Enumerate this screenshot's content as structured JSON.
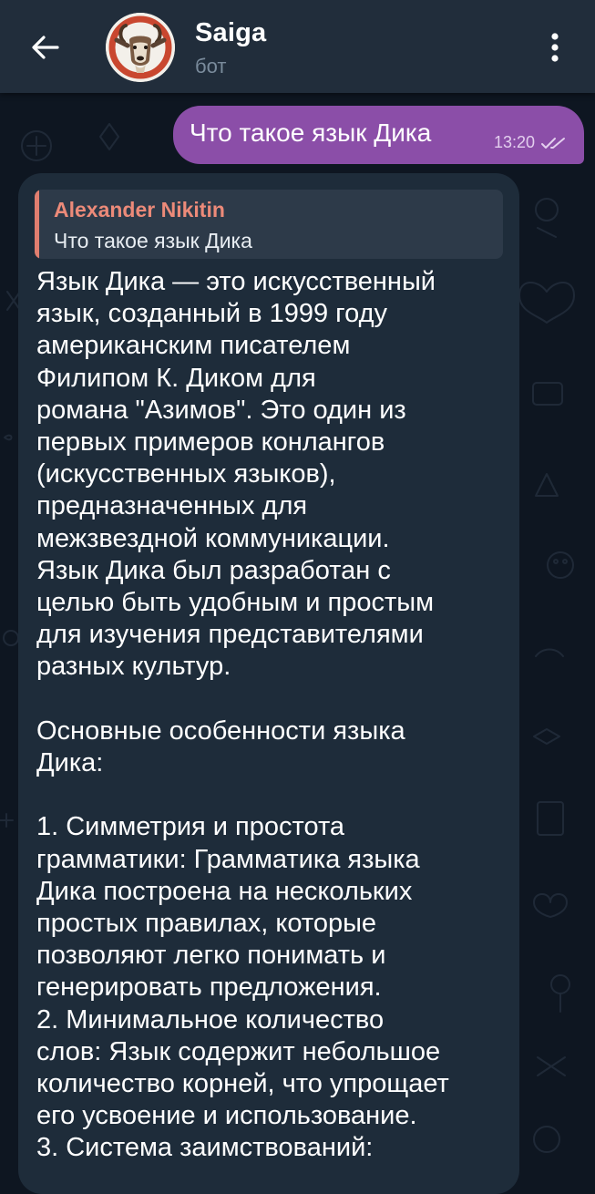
{
  "colors": {
    "background": "#0e1621",
    "header": "#212d3b",
    "outgoing_bubble": "#8b4ea8",
    "incoming_bubble": "#1e2c3a",
    "reply_accent": "#ec8a79"
  },
  "header": {
    "back_icon": "arrow-left-icon",
    "avatar_icon": "goat-avatar",
    "title": "Saiga",
    "subtitle": "бот",
    "menu_icon": "more-vertical-icon"
  },
  "outgoing": {
    "text": "Что такое язык Дика",
    "time": "13:20",
    "status_icon": "double-check-icon"
  },
  "incoming": {
    "reply_author": "Alexander Nikitin",
    "reply_text": "Что такое язык Дика",
    "lines": [
      "Язык Дика — это искусственный",
      "язык, созданный в 1999 году",
      "американским писателем",
      "Филипом К. Диком для",
      "романа \"Азимов\". Это один из",
      "первых примеров конлангов",
      "(искусственных языков),",
      "предназначенных для",
      "межзвездной коммуникации.",
      "Язык Дика был разработан с",
      "целью быть удобным и простым",
      "для изучения представителями",
      "разных культур.",
      "",
      "Основные особенности языка",
      "Дика:",
      "",
      "1. Симметрия и простота",
      "грамматики: Грамматика языка",
      "Дика построена на нескольких",
      "простых правилах, которые",
      "позволяют легко понимать и",
      "генерировать предложения.",
      "2. Минимальное количество",
      "слов: Язык содержит небольшое",
      "количество корней, что упрощает",
      "его усвоение и использование.",
      "3. Система заимствований:"
    ]
  }
}
